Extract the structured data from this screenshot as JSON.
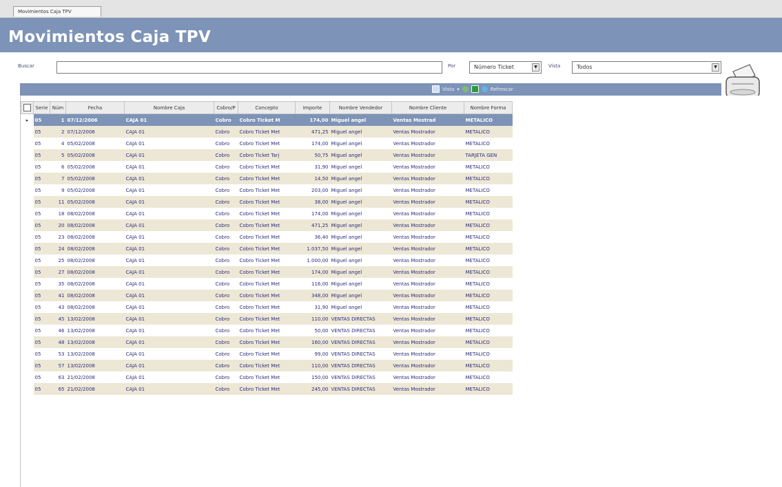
{
  "tab": {
    "label": "Movimientos Caja TPV"
  },
  "page": {
    "title": "Movimientos Caja TPV"
  },
  "search": {
    "buscar_label": "Buscar",
    "buscar_value": "",
    "por_label": "Por",
    "por_value": "Número Ticket",
    "vista_label": "Vista",
    "vista_value": "Todos"
  },
  "toolbar": {
    "vista_label": "Vista",
    "refrescar_label": "Refrescar"
  },
  "icons": {
    "printer": "printer-icon",
    "vista": "view-icon",
    "excel": "excel-icon",
    "refresh": "refresh-icon"
  },
  "grid": {
    "columns": [
      "Serie",
      "Núm",
      "Fecha",
      "Nombre Caja",
      "Cobro/P",
      "Concepto",
      "Importe",
      "Nombre Vendedor",
      "Nombre Cliente",
      "Nombre Forma"
    ],
    "rows": [
      [
        "05",
        "1",
        "07/12/2006",
        "CAJA 01",
        "Cobro",
        "Cobro Ticket M",
        "174,00",
        "Miguel angel",
        "Ventas Mostrad",
        "METALICO"
      ],
      [
        "05",
        "2",
        "07/12/2006",
        "CAJA 01",
        "Cobro",
        "Cobro Ticket Met",
        "471,25",
        "Miguel angel",
        "Ventas Mostrador",
        "METALICO"
      ],
      [
        "05",
        "4",
        "05/02/2008",
        "CAJA 01",
        "Cobro",
        "Cobro Ticket Met",
        "174,00",
        "Miguel angel",
        "Ventas Mostrador",
        "METALICO"
      ],
      [
        "05",
        "5",
        "05/02/2008",
        "CAJA 01",
        "Cobro",
        "Cobro Ticket Tarj",
        "50,75",
        "Miguel angel",
        "Ventas Mostrador",
        "TARJETA GEN"
      ],
      [
        "05",
        "6",
        "05/02/2008",
        "CAJA 01",
        "Cobro",
        "Cobro Ticket Met",
        "31,90",
        "Miguel angel",
        "Ventas Mostrador",
        "METALICO"
      ],
      [
        "05",
        "7",
        "05/02/2008",
        "CAJA 01",
        "Cobro",
        "Cobro Ticket Met",
        "14,50",
        "Miguel angel",
        "Ventas Mostrador",
        "METALICO"
      ],
      [
        "05",
        "9",
        "05/02/2008",
        "CAJA 01",
        "Cobro",
        "Cobro Ticket Met",
        "203,00",
        "Miguel angel",
        "Ventas Mostrador",
        "METALICO"
      ],
      [
        "05",
        "11",
        "05/02/2008",
        "CAJA 01",
        "Cobro",
        "Cobro Ticket Met",
        "38,00",
        "Miguel angel",
        "Ventas Mostrador",
        "METALICO"
      ],
      [
        "05",
        "18",
        "08/02/2008",
        "CAJA 01",
        "Cobro",
        "Cobro Ticket Met",
        "174,00",
        "Miguel angel",
        "Ventas Mostrador",
        "METALICO"
      ],
      [
        "05",
        "20",
        "08/02/2008",
        "CAJA 01",
        "Cobro",
        "Cobro Ticket Met",
        "471,25",
        "Miguel angel",
        "Ventas Mostrador",
        "METALICO"
      ],
      [
        "05",
        "23",
        "08/02/2008",
        "CAJA 01",
        "Cobro",
        "Cobro Ticket Met",
        "36,40",
        "Miguel angel",
        "Ventas Mostrador",
        "METALICO"
      ],
      [
        "05",
        "24",
        "08/02/2008",
        "CAJA 01",
        "Cobro",
        "Cobro Ticket Met",
        "1.037,50",
        "Miguel angel",
        "Ventas Mostrador",
        "METALICO"
      ],
      [
        "05",
        "25",
        "08/02/2008",
        "CAJA 01",
        "Cobro",
        "Cobro Ticket Met",
        "1.000,00",
        "Miguel angel",
        "Ventas Mostrador",
        "METALICO"
      ],
      [
        "05",
        "27",
        "08/02/2008",
        "CAJA 01",
        "Cobro",
        "Cobro Ticket Met",
        "174,00",
        "Miguel angel",
        "Ventas Mostrador",
        "METALICO"
      ],
      [
        "05",
        "35",
        "08/02/2008",
        "CAJA 01",
        "Cobro",
        "Cobro Ticket Met",
        "116,00",
        "Miguel angel",
        "Ventas Mostrador",
        "METALICO"
      ],
      [
        "05",
        "41",
        "08/02/2008",
        "CAJA 01",
        "Cobro",
        "Cobro Ticket Met",
        "348,00",
        "Miguel angel",
        "Ventas Mostrador",
        "METALICO"
      ],
      [
        "05",
        "43",
        "08/02/2008",
        "CAJA 01",
        "Cobro",
        "Cobro Ticket Met",
        "31,90",
        "Miguel angel",
        "Ventas Mostrador",
        "METALICO"
      ],
      [
        "05",
        "45",
        "13/02/2008",
        "CAJA 01",
        "Cobro",
        "Cobro Ticket Met",
        "110,00",
        "VENTAS DIRECTAS",
        "Ventas Mostrador",
        "METALICO"
      ],
      [
        "05",
        "46",
        "13/02/2008",
        "CAJA 01",
        "Cobro",
        "Cobro Ticket Met",
        "50,00",
        "VENTAS DIRECTAS",
        "Ventas Mostrador",
        "METALICO"
      ],
      [
        "05",
        "48",
        "13/02/2008",
        "CAJA 01",
        "Cobro",
        "Cobro Ticket Met",
        "160,00",
        "VENTAS DIRECTAS",
        "Ventas Mostrador",
        "METALICO"
      ],
      [
        "05",
        "53",
        "13/02/2008",
        "CAJA 01",
        "Cobro",
        "Cobro Ticket Met",
        "99,00",
        "VENTAS DIRECTAS",
        "Ventas Mostrador",
        "METALICO"
      ],
      [
        "05",
        "57",
        "13/02/2008",
        "CAJA 01",
        "Cobro",
        "Cobro Ticket Met",
        "110,00",
        "VENTAS DIRECTAS",
        "Ventas Mostrador",
        "METALICO"
      ],
      [
        "05",
        "63",
        "21/02/2008",
        "CAJA 01",
        "Cobro",
        "Cobro Ticket Met",
        "150,00",
        "VENTAS DIRECTAS",
        "Ventas Mostrador",
        "METALICO"
      ],
      [
        "05",
        "65",
        "21/02/2008",
        "CAJA 01",
        "Cobro",
        "Cobro Ticket Met",
        "245,00",
        "VENTAS DIRECTAS",
        "Ventas Mostrador",
        "METALICO"
      ]
    ]
  },
  "colors": {
    "header_blue": "#7d93b7",
    "row_alt": "#ede7d6",
    "text_blue": "#2c2c7c"
  }
}
